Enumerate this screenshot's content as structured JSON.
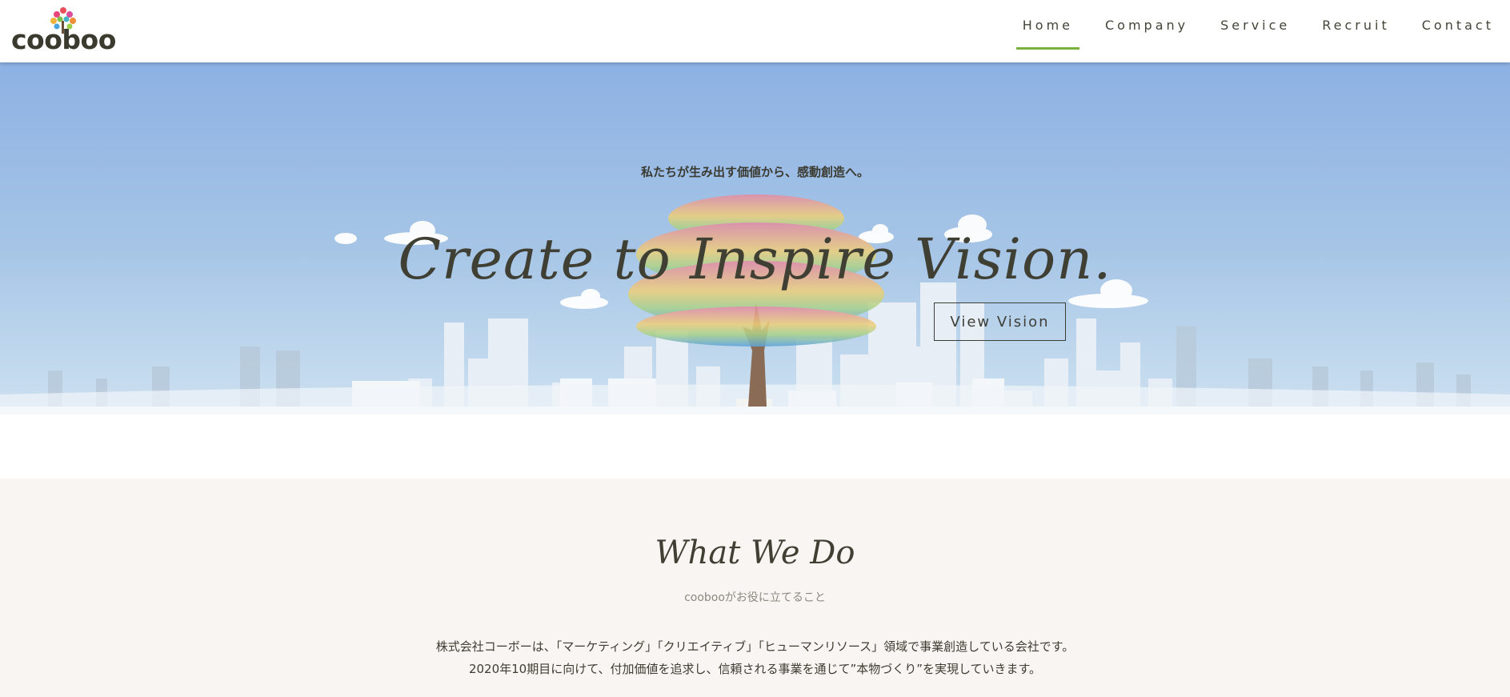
{
  "brand": {
    "logo_text": "cooboo"
  },
  "nav": {
    "items": [
      {
        "label": "Home",
        "active": true
      },
      {
        "label": "Company",
        "active": false
      },
      {
        "label": "Service",
        "active": false
      },
      {
        "label": "Recruit",
        "active": false
      },
      {
        "label": "Contact",
        "active": false
      }
    ]
  },
  "hero": {
    "subtitle": "私たちが生み出す価値から、感動創造へ。",
    "title": "Create to Inspire Vision.",
    "button_label": "View Vision"
  },
  "what_we_do": {
    "title": "What We Do",
    "subtitle": "coobooがお役に立てること",
    "body_line1": "株式会社コーボーは、「マーケティング」「クリエイティブ」「ヒューマンリソース」領域で事業創造している会社です。",
    "body_line2": "2020年10期目に向けて、付加価値を追求し、信頼される事業を通じて”本物づくり”を実現していきます。"
  },
  "colors": {
    "accent": "#7ab03e",
    "text": "#3d3d33",
    "sky_top": "#8db1e3",
    "section_bg": "#f8f5f2"
  }
}
